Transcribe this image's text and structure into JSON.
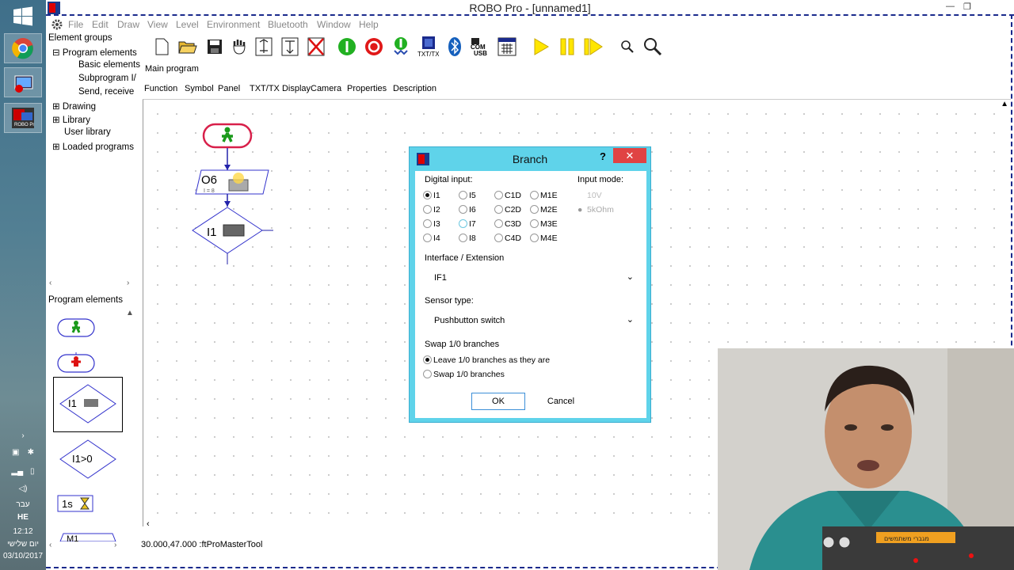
{
  "app": {
    "title": "ROBO Pro - [unnamed1]"
  },
  "menu": [
    "File",
    "Edit",
    "Draw",
    "View",
    "Level",
    "Environment",
    "Bluetooth",
    "Window",
    "Help"
  ],
  "tree": {
    "header": "Element groups",
    "items": [
      {
        "label": "Program elements",
        "prefix": "⊟"
      },
      {
        "label": "Basic elements",
        "prefix": ""
      },
      {
        "label": "Subprogram I/",
        "prefix": ""
      },
      {
        "label": "Send, receive",
        "prefix": ""
      },
      {
        "label": "Drawing",
        "prefix": "⊞"
      },
      {
        "label": "Library",
        "prefix": "⊞"
      },
      {
        "label": "User library",
        "prefix": ""
      },
      {
        "label": "Loaded programs",
        "prefix": "⊞"
      }
    ]
  },
  "palette": {
    "label": "Program elements",
    "items": [
      "I1",
      "I1>0",
      "1s",
      "M1"
    ]
  },
  "toolbar": {
    "icons": [
      "new-file-icon",
      "open-folder-icon",
      "save-icon",
      "pan-hand-icon",
      "download-icon",
      "upload-icon",
      "delete-icon",
      "start-icon",
      "stop-icon",
      "online-icon",
      "txt-tx-icon",
      "bluetooth-icon",
      "com-usb-icon",
      "panel-icon",
      "play-icon",
      "pause-icon",
      "step-icon",
      "zoom-icon",
      "search-icon"
    ],
    "txt_label": "TXT/TX",
    "com_label": "COM USB"
  },
  "main_program_label": "Main program",
  "tabs": [
    "Function",
    "Symbol",
    "Panel",
    "TXT/TX Display",
    "Camera",
    "Properties",
    "Description"
  ],
  "flowchart": {
    "output_label": "O6",
    "output_sub": "I = 8",
    "branch_label": "I1"
  },
  "status": "30.000,47.000 :ftProMasterTool",
  "dialog": {
    "title": "Branch",
    "help": "?",
    "digital_input_label": "Digital input:",
    "input_mode_label": "Input mode:",
    "inputs": [
      [
        "I1",
        "I5",
        "C1D",
        "M1E"
      ],
      [
        "I2",
        "I6",
        "C2D",
        "M2E"
      ],
      [
        "I3",
        "I7",
        "C3D",
        "M3E"
      ],
      [
        "I4",
        "I8",
        "C4D",
        "M4E"
      ]
    ],
    "selected_input": "I1",
    "modes": [
      "10V",
      "5kOhm"
    ],
    "interface_label": "Interface / Extension",
    "interface_value": "IF1",
    "sensor_label": "Sensor type:",
    "sensor_value": "Pushbutton switch",
    "swap_label": "Swap 1/0 branches",
    "swap_options": [
      "Leave 1/0 branches as they are",
      "Swap 1/0 branches"
    ],
    "ok": "OK",
    "cancel": "Cancel"
  },
  "tray": {
    "lang": "HE",
    "lang2": "עבר",
    "time": "12:12",
    "day": "יום שלישי",
    "date": "03/10/2017"
  },
  "webcam": {
    "board_label": "מגברי משתמשים"
  }
}
